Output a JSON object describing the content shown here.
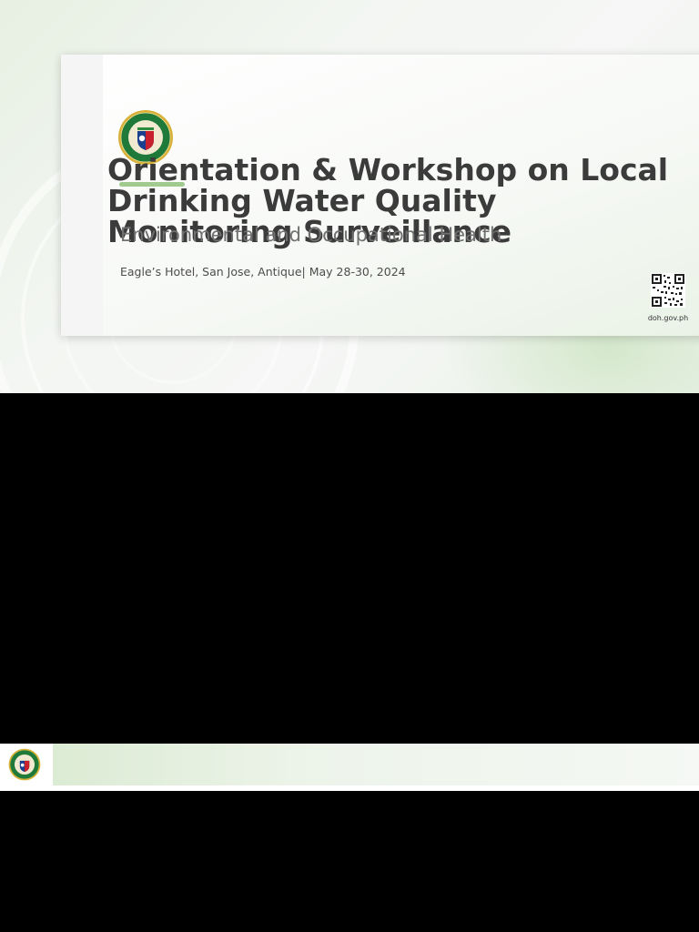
{
  "slides": [
    {
      "title": "Orientation & Workshop on Local\nDrinking Water Quality\nMonitoring Surveillance",
      "subtitle": "Environmental and Occupational Health",
      "event": "Eagle’s Hotel, San Jose, Antique| May 28-30, 2024",
      "seal_text": "REPUBLIC OF THE PHILIPPINES • DEPARTMENT OF HEALTH",
      "qr_caption": "doh.gov.ph",
      "icons": [
        "doh-seal-icon",
        "qr-code-icon"
      ]
    },
    {
      "icons": [
        "doh-seal-icon"
      ]
    }
  ],
  "colors": {
    "accent_green": "#8fc17a",
    "title_text": "#3b3b3b",
    "subtitle_text": "#707070",
    "seal_ring": "#1f7a3a",
    "seal_gold": "#d7b13a",
    "viewer_background": "#000000"
  }
}
